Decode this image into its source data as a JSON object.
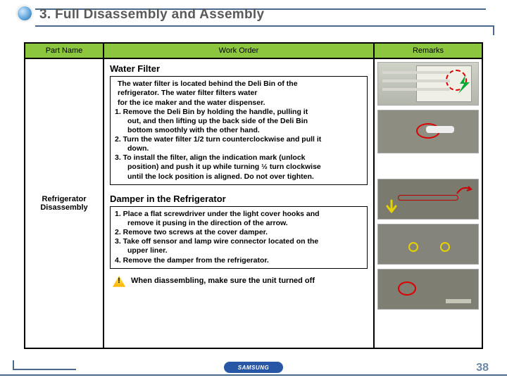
{
  "page": {
    "title": "3. Full Disassembly and Assembly",
    "number": "38",
    "brand": "SAMSUNG"
  },
  "table": {
    "headers": {
      "col1": "Part Name",
      "col2": "Work Order",
      "col3": "Remarks"
    },
    "partName": "Refrigerator Disassembly"
  },
  "sections": {
    "waterFilter": {
      "title": "Water Filter",
      "intro1": "The water filter is located behind the Deli Bin of the",
      "intro2": "refrigerator. The water filter filters water",
      "intro3": "for the ice maker and the water dispenser.",
      "s1a": "1. Remove the Deli Bin by holding the handle, pulling it",
      "s1b": "out, and then lifting up the back side of the Deli Bin",
      "s1c": "bottom smoothly with the other hand.",
      "s2a": "2. Turn the water filter 1/2 turn counterclockwise and pull it",
      "s2b": "down.",
      "s3a": "3. To install the filter, align the indication mark (unlock",
      "s3b": "position) and push it up while turning ½ turn clockwise",
      "s3c": "until the lock position is aligned. Do not over tighten."
    },
    "damper": {
      "title": "Damper in the Refrigerator",
      "s1a": "1. Place a flat screwdriver under the light cover hooks and",
      "s1b": "remove it pusing in the direction of the arrow.",
      "s2": "2. Remove two screws at the cover damper.",
      "s3a": "3. Take off sensor and lamp wire connector located on the",
      "s3b": "upper liner.",
      "s4": "4. Remove the damper from the refrigerator."
    },
    "warning": "When diassembling, make sure the unit turned off"
  }
}
